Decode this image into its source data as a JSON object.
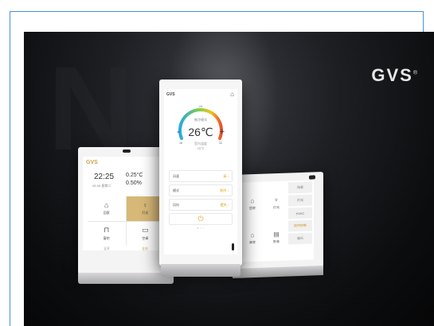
{
  "brand": {
    "logo": "GVS",
    "mark": "®",
    "background_letters": "N"
  },
  "left_panel": {
    "logo": "GVS",
    "settings_icon": "gear-icon",
    "time": "22:25",
    "date": "05-08 星期二",
    "temperature": "0.25°C",
    "humidity": "0.50%",
    "tiles": [
      {
        "icon": "home-icon",
        "label": "回家",
        "active": false
      },
      {
        "icon": "bulb-icon",
        "label": "灯光",
        "active": true
      },
      {
        "icon": "curtain-icon",
        "label": "窗帘",
        "active": false
      },
      {
        "icon": "ac-icon",
        "label": "空调",
        "active": false
      }
    ],
    "footer": [
      "全开",
      "全关"
    ]
  },
  "center_panel": {
    "logo": "GVS",
    "home_icon": "home-icon",
    "dial_labels": [
      "24",
      "16",
      "32"
    ],
    "mode_label": "制冷模式",
    "setpoint": "26℃",
    "minus": "-",
    "plus": "+",
    "current_label": "室内温度",
    "current_temp": "25℃",
    "rows": [
      {
        "label": "风速",
        "value": "高 ›"
      },
      {
        "label": "模式",
        "value": "制冷 ›"
      },
      {
        "label": "风向",
        "value": "摆风 ›"
      }
    ],
    "power_icon": "power-icon",
    "accent": "#e8a030"
  },
  "right_panel": {
    "tiles": [
      {
        "icon": "home-icon",
        "label": "回家"
      },
      {
        "icon": "lamp-icon",
        "label": "灯光"
      },
      {
        "icon": "home-outline-icon",
        "label": "离家"
      },
      {
        "icon": "tv-icon",
        "label": "影音"
      }
    ],
    "side_menu": [
      "场景",
      "灯光",
      "HVAC",
      "窗帘控制",
      "音乐"
    ],
    "selected_index": 3
  }
}
